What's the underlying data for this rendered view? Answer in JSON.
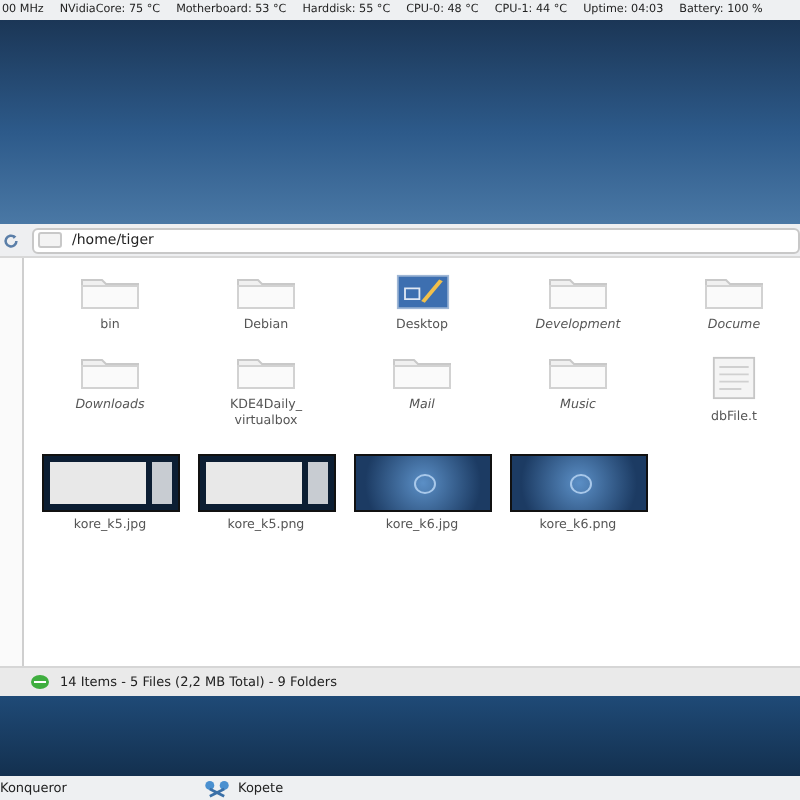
{
  "system_monitor": [
    "00 MHz",
    "NVidiaCore: 75 °C",
    "Motherboard: 53 °C",
    "Harddisk: 55 °C",
    "CPU-0: 48 °C",
    "CPU-1: 44 °C",
    "Uptime: 04:03",
    "Battery: 100 %"
  ],
  "file_manager": {
    "location": "/home/tiger",
    "items": [
      {
        "name": "bin",
        "kind": "folder",
        "italic": false
      },
      {
        "name": "Debian",
        "kind": "folder",
        "italic": false
      },
      {
        "name": "Desktop",
        "kind": "desktop",
        "italic": false
      },
      {
        "name": "Development",
        "kind": "folder",
        "italic": true
      },
      {
        "name": "Docume",
        "kind": "folder",
        "italic": true
      },
      {
        "name": "Downloads",
        "kind": "folder",
        "italic": true
      },
      {
        "name": "KDE4Daily_ virtualbox",
        "kind": "folder",
        "italic": false
      },
      {
        "name": "Mail",
        "kind": "folder",
        "italic": true
      },
      {
        "name": "Music",
        "kind": "folder",
        "italic": true
      },
      {
        "name": "dbFile.t",
        "kind": "document",
        "italic": false
      },
      {
        "name": "kore_k5.jpg",
        "kind": "screenshot",
        "italic": false
      },
      {
        "name": "kore_k5.png",
        "kind": "screenshot",
        "italic": false
      },
      {
        "name": "kore_k6.jpg",
        "kind": "wallpaper",
        "italic": false
      },
      {
        "name": "kore_k6.png",
        "kind": "wallpaper",
        "italic": false
      }
    ],
    "status": "14 Items - 5 Files (2,2 MB Total) - 9 Folders"
  },
  "taskbar": [
    {
      "label": "Konqueror",
      "kind": "plain"
    },
    {
      "label": "Kopete",
      "kind": "kopete"
    }
  ]
}
